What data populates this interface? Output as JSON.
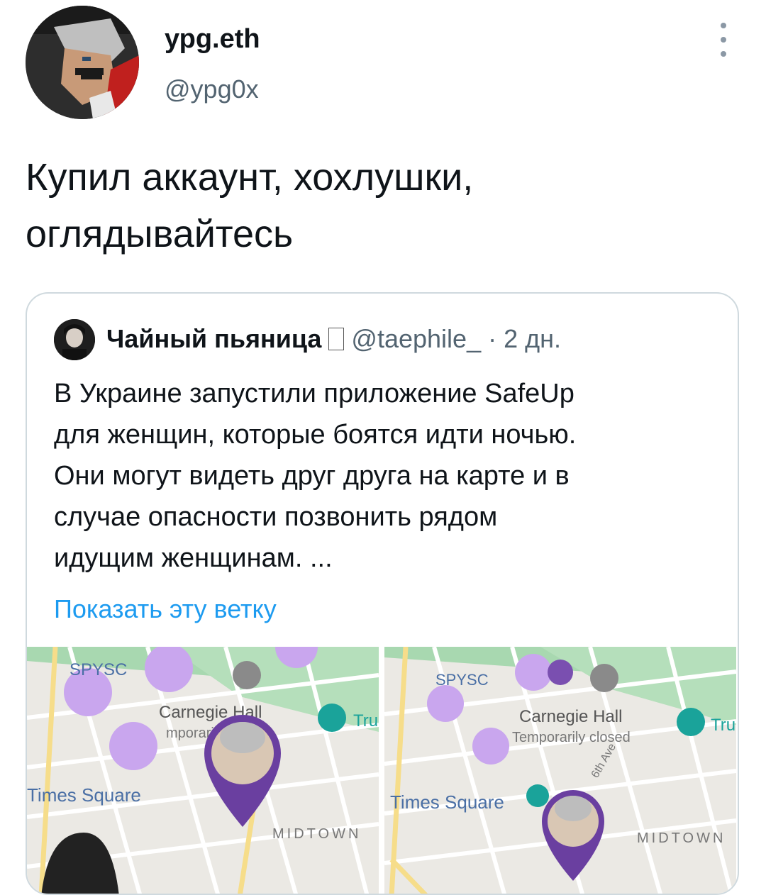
{
  "user": {
    "display_name": "урg.eth",
    "handle": "@ypg0x"
  },
  "tweet": {
    "text": "Купил аккаунт, хохлушки,\nоглядывайтесь"
  },
  "quote": {
    "name": "Чайный пьяница",
    "handle": "@taephile_",
    "dot": "·",
    "time": "2 дн.",
    "text": "В Украине запустили приложение SafeUp\nдля женщин, которые боятся идти ночью.\nОни могут видеть друг друга на карте и в\nслучае опасности позвонить рядом\nидущим женщинам. ...",
    "show_thread": "Показать эту ветку"
  },
  "map_labels": {
    "poi_short": "SPYSC",
    "hall": "Carnegie Hall",
    "closed_left": "mporarily closed",
    "closed_right": "Temporarily closed",
    "square": "Times Square",
    "midtown": "MIDTOWN",
    "tru": "Tru",
    "ave": "6th Ave"
  },
  "colors": {
    "link": "#1d9bf0",
    "secondary": "#536471",
    "map_pin": "#6a3fa0",
    "map_bubble": "#c9a6ee"
  }
}
